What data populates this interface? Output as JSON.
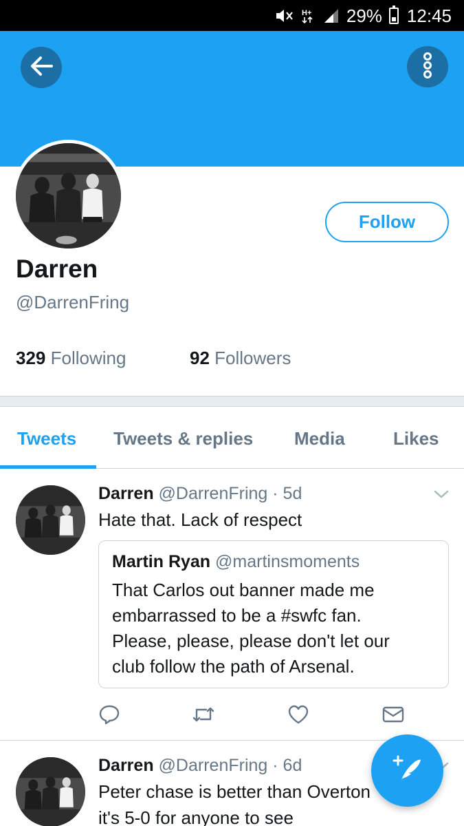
{
  "status_bar": {
    "battery": "29%",
    "time": "12:45",
    "network": "H+"
  },
  "profile": {
    "display_name": "Darren",
    "handle": "@DarrenFring",
    "follow_label": "Follow",
    "following_count": "329",
    "following_label": "Following",
    "followers_count": "92",
    "followers_label": "Followers"
  },
  "tabs": [
    {
      "label": "Tweets",
      "active": true
    },
    {
      "label": "Tweets & replies",
      "active": false
    },
    {
      "label": "Media",
      "active": false
    },
    {
      "label": "Likes",
      "active": false
    }
  ],
  "tweets": [
    {
      "name": "Darren",
      "handle": "@DarrenFring",
      "time": "· 5d",
      "lines": [
        "Hate that. Lack of respect"
      ],
      "quote": {
        "name": "Martin Ryan",
        "handle": "@martinsmoments",
        "lines": [
          "That Carlos out banner made me",
          "embarrassed to be a #swfc fan.",
          "Please, please, please don't let our",
          "club follow the path of Arsenal."
        ]
      }
    },
    {
      "name": "Darren",
      "handle": "@DarrenFring",
      "time": "· 6d",
      "lines": [
        "Peter chase is better than Overton",
        "it's 5-0 for anyone to see"
      ]
    }
  ],
  "icons": {
    "back": "arrow-left-icon",
    "more": "more-vertical-icon",
    "reply": "reply-icon",
    "retweet": "retweet-icon",
    "like": "heart-icon",
    "dm": "envelope-icon",
    "compose": "compose-quill-icon",
    "chevron": "chevron-down-icon"
  },
  "colors": {
    "brand": "#1da1f2",
    "banner": "#1da1f2",
    "muted_text": "#657786",
    "primary_text": "#14171a",
    "divider": "#e6ecf0"
  }
}
